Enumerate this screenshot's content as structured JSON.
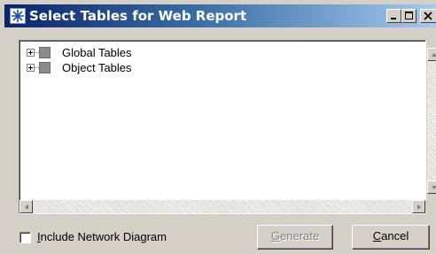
{
  "window": {
    "title": "Select Tables for Web Report"
  },
  "titlebar_buttons": [
    "minimize",
    "maximize",
    "close"
  ],
  "tree": {
    "items": [
      {
        "label": "Global Tables",
        "expander": "+"
      },
      {
        "label": "Object Tables",
        "expander": "+"
      }
    ]
  },
  "options": {
    "include_network_diagram": {
      "mnemonic": "I",
      "rest": "nclude Network Diagram",
      "checked": false
    }
  },
  "buttons": {
    "generate": {
      "mnemonic": "G",
      "rest": "enerate",
      "enabled": false
    },
    "cancel": {
      "mnemonic": "C",
      "rest": "ancel",
      "enabled": true
    }
  },
  "colors": {
    "titlebar_start": "#0a246a",
    "titlebar_end": "#a6caf0",
    "face": "#d4d0c8"
  }
}
